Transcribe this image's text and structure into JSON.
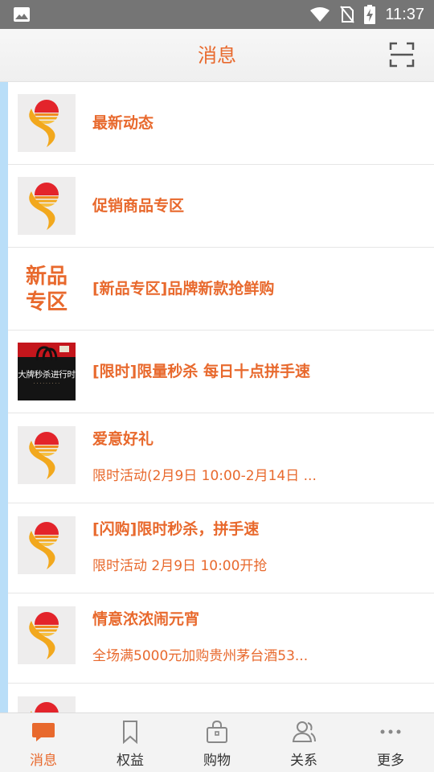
{
  "status_bar": {
    "time": "11:37",
    "icons": [
      "image-icon",
      "wifi-icon",
      "no-sim-icon",
      "battery-charging-icon"
    ]
  },
  "header": {
    "title": "消息",
    "right_icon": "scan-icon"
  },
  "messages": [
    {
      "thumb": "sun-logo",
      "title": "最新动态"
    },
    {
      "thumb": "sun-logo",
      "title": "促销商品专区"
    },
    {
      "thumb": "new-product-badge",
      "thumb_text": [
        "新品",
        "专区"
      ],
      "title": "[新品专区]品牌新款抢鲜购"
    },
    {
      "thumb": "flash-sale-banner",
      "thumb_text": "大牌秒杀进行时",
      "title": "[限时]限量秒杀 每日十点拼手速"
    },
    {
      "thumb": "sun-logo",
      "title": "爱意好礼",
      "subtitle": "限时活动(2月9日 10:00-2月14日 ..."
    },
    {
      "thumb": "sun-logo",
      "title": "[闪购]限时秒杀，拼手速",
      "subtitle": "限时活动 2月9日 10:00开抢"
    },
    {
      "thumb": "sun-logo",
      "title": "情意浓浓闹元宵",
      "subtitle": "全场满5000元加购贵州茅台酒53..."
    },
    {
      "thumb": "sun-logo",
      "title": ""
    }
  ],
  "tabs": [
    {
      "label": "消息",
      "icon": "chat-bubble-icon",
      "active": true
    },
    {
      "label": "权益",
      "icon": "bookmark-icon",
      "active": false
    },
    {
      "label": "购物",
      "icon": "shopping-bag-icon",
      "active": false
    },
    {
      "label": "关系",
      "icon": "contacts-icon",
      "active": false
    },
    {
      "label": "更多",
      "icon": "more-dots-icon",
      "active": false
    }
  ],
  "colors": {
    "accent": "#e8692d",
    "status_bar": "#757575",
    "list_accent_bar": "#b9def8",
    "logo_red": "#e3242b",
    "logo_yellow": "#f2a81d"
  }
}
